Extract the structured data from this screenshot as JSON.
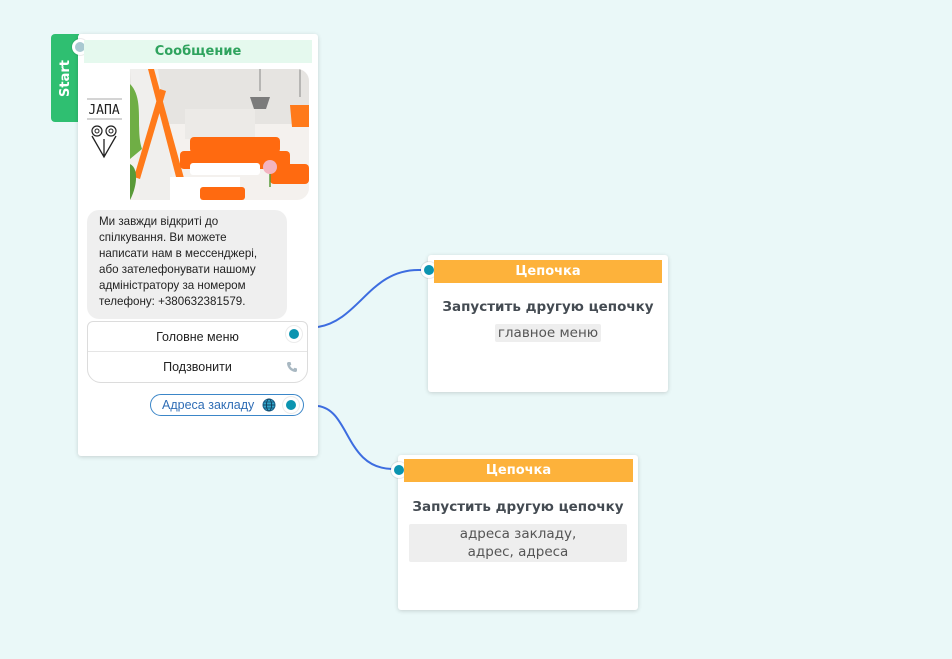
{
  "start": {
    "label": "Start"
  },
  "message_node": {
    "header": "Сообщение",
    "logo_text": "ЈАПА",
    "text": "Ми завжди відкриті до спілкування. Ви можете написати нам в мессенджері, або зателефонувати нашому адміністратору за номером телефону: +380632381579.",
    "buttons": [
      {
        "label": "Головне меню",
        "icon": "connector-port"
      },
      {
        "label": "Подзвонити",
        "icon": "phone-icon"
      }
    ],
    "link_button": {
      "label": "Адреса закладу",
      "icon": "globe-icon"
    }
  },
  "chain_nodes": [
    {
      "header": "Цепочка",
      "title": "Запустить другую цепочку",
      "tag": "главное меню"
    },
    {
      "header": "Цепочка",
      "title": "Запустить другую цепочку",
      "tag": "адреса закладу, адрес, адреса"
    }
  ],
  "colors": {
    "canvas": "#eaf8f8",
    "start_green": "#2fbf71",
    "message_header_bg": "#e5f9ee",
    "chain_header": "#fdb23b",
    "port": "#0b94b0",
    "connector": "#3d6de0"
  }
}
